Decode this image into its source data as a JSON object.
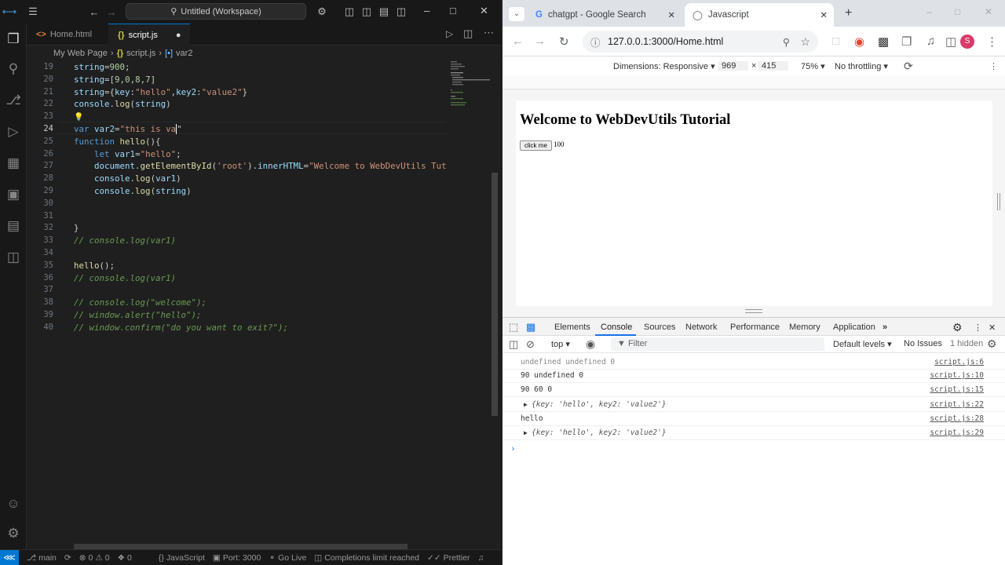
{
  "vscode": {
    "title": "Untitled (Workspace)",
    "tabs": [
      {
        "label": "Home.html",
        "icon": "<>"
      },
      {
        "label": "script.js",
        "icon": "{}"
      }
    ],
    "breadcrumb": [
      "My Web Page",
      "script.js",
      "var2"
    ],
    "line_numbers": [
      "19",
      "20",
      "21",
      "22",
      "23",
      "24",
      "25",
      "26",
      "27",
      "28",
      "29",
      "30",
      "31",
      "32",
      "33",
      "34",
      "35",
      "36",
      "37",
      "38",
      "39",
      "40"
    ],
    "status": {
      "branch": "main",
      "errors": "0",
      "warnings": "0",
      "ports": "0",
      "language": "JavaScript",
      "port": "Port: 3000",
      "golive": "Go Live",
      "completions": "Completions limit reached",
      "prettier": "Prettier"
    }
  },
  "chrome": {
    "tabs": [
      {
        "label": "chatgpt - Google Search"
      },
      {
        "label": "Javascript"
      }
    ],
    "url": "127.0.0.1:3000/Home.html",
    "profile_initial": "S",
    "device": {
      "dimensions": "Dimensions: Responsive",
      "width": "969",
      "times": "×",
      "height": "415",
      "zoom": "75%",
      "throttle": "No throttling"
    },
    "page": {
      "heading": "Welcome to WebDevUtils Tutorial",
      "button": "click me",
      "value": "100"
    },
    "devtools": {
      "tabs": [
        "Elements",
        "Console",
        "Sources",
        "Network",
        "Performance",
        "Memory",
        "Application"
      ],
      "context": "top",
      "filter": "Filter",
      "levels": "Default levels",
      "issues": "No Issues",
      "hidden": "1 hidden",
      "rows": [
        {
          "msg": "undefined undefined 0",
          "src": "script.js:6"
        },
        {
          "msg": "90 undefined 0",
          "src": "script.js:10"
        },
        {
          "msg": "90 60 0",
          "src": "script.js:15"
        },
        {
          "msg": "{key: 'hello', key2: 'value2'}",
          "src": "script.js:22"
        },
        {
          "msg": "hello",
          "src": "script.js:28"
        },
        {
          "msg": "{key: 'hello', key2: 'value2'}",
          "src": "script.js:29"
        }
      ]
    }
  },
  "colors": {
    "accent": "#0078d4",
    "keyword": "#569cd6",
    "string": "#ce9178",
    "function": "#dcdcaa",
    "comment": "#6a9955"
  }
}
